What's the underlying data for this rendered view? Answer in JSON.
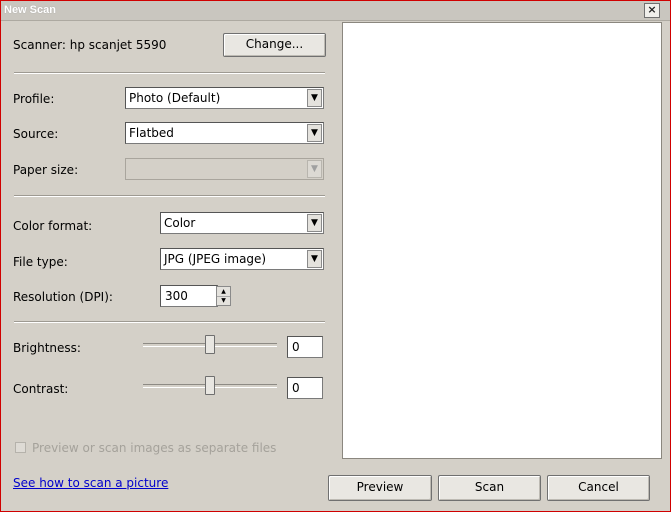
{
  "window": {
    "title": "New Scan",
    "close_glyph": "×"
  },
  "scanner": {
    "label": "Scanner: hp scanjet 5590",
    "change_button": "Change..."
  },
  "profile": {
    "label": "Profile:",
    "value": "Photo (Default)"
  },
  "source": {
    "label": "Source:",
    "value": "Flatbed"
  },
  "paper_size": {
    "label": "Paper size:",
    "value": ""
  },
  "color_format": {
    "label": "Color format:",
    "value": "Color"
  },
  "file_type": {
    "label": "File type:",
    "value": "JPG (JPEG image)"
  },
  "resolution": {
    "label": "Resolution (DPI):",
    "value": "300"
  },
  "brightness": {
    "label": "Brightness:",
    "value": "0",
    "level": 0
  },
  "contrast": {
    "label": "Contrast:",
    "value": "0",
    "level": 0
  },
  "separate_files": {
    "label": "Preview or scan images as separate files",
    "checked": false,
    "enabled": false
  },
  "help_link": "See how to scan a picture",
  "buttons": {
    "preview": "Preview",
    "scan": "Scan",
    "cancel": "Cancel"
  },
  "icons": {
    "dropdown": "chevron-down-icon",
    "spin_up": "arrow-up-icon",
    "spin_down": "arrow-down-icon",
    "close": "close-icon"
  }
}
